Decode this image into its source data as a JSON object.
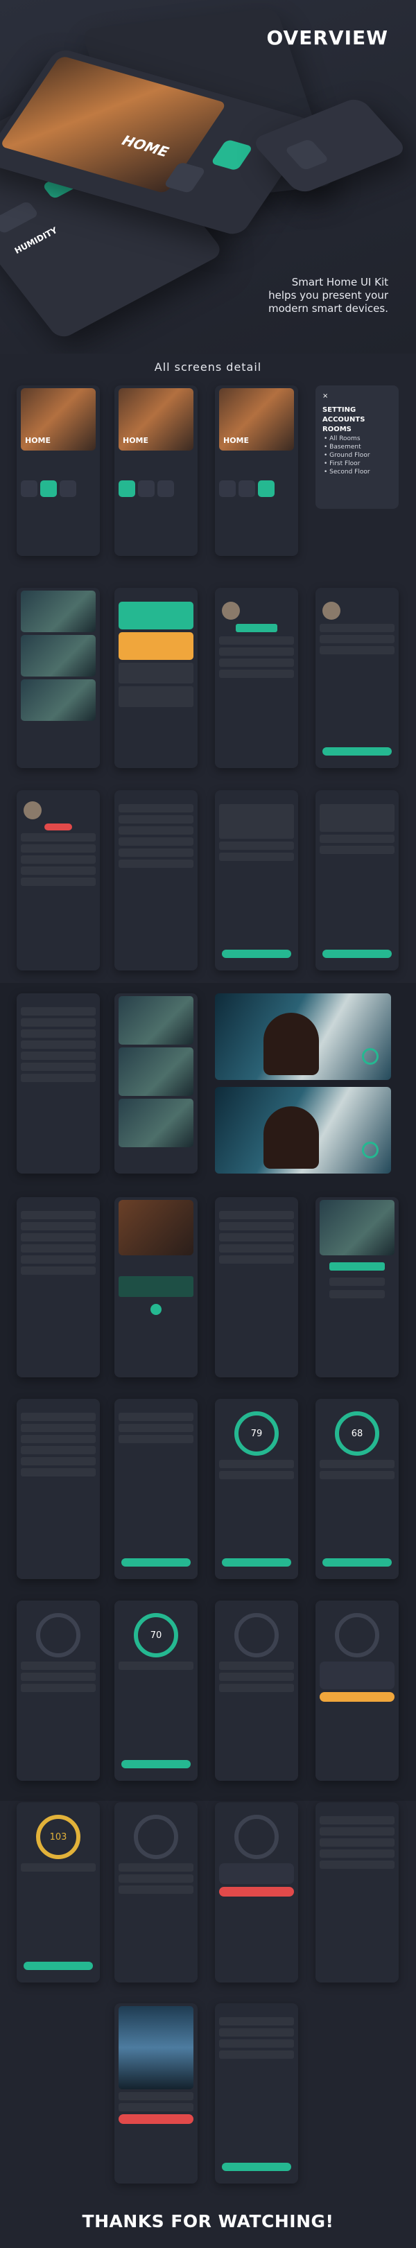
{
  "hero": {
    "title": "OVERVIEW",
    "desc_lines": [
      "Smart Home UI Kit",
      "helps you present your",
      "modern smart devices."
    ],
    "home_label": "HOME",
    "humidity_label": "HUMIDITY"
  },
  "section": {
    "title": "All screens detail"
  },
  "screens_row1": [
    {
      "img_label": "HOME"
    },
    {
      "img_label": "HOME"
    },
    {
      "img_label": "HOME"
    }
  ],
  "menu": {
    "close": "×",
    "items": [
      "SETTING",
      "ACCOUNTS",
      "ROOMS"
    ],
    "sub_items": [
      "• All Rooms",
      "• Basement",
      "• Ground Floor",
      "• First Floor",
      "• Second Floor"
    ]
  },
  "gauges": {
    "g1": "79",
    "g2": "68",
    "g3": "70",
    "g4": "103"
  },
  "footer": {
    "thanks": "THANKS FOR WATCHING!"
  },
  "colors": {
    "accent": "#25b891",
    "background": "#22252f",
    "card": "#262a35",
    "gold": "#e2b23a",
    "alert": "#e24a4a"
  }
}
